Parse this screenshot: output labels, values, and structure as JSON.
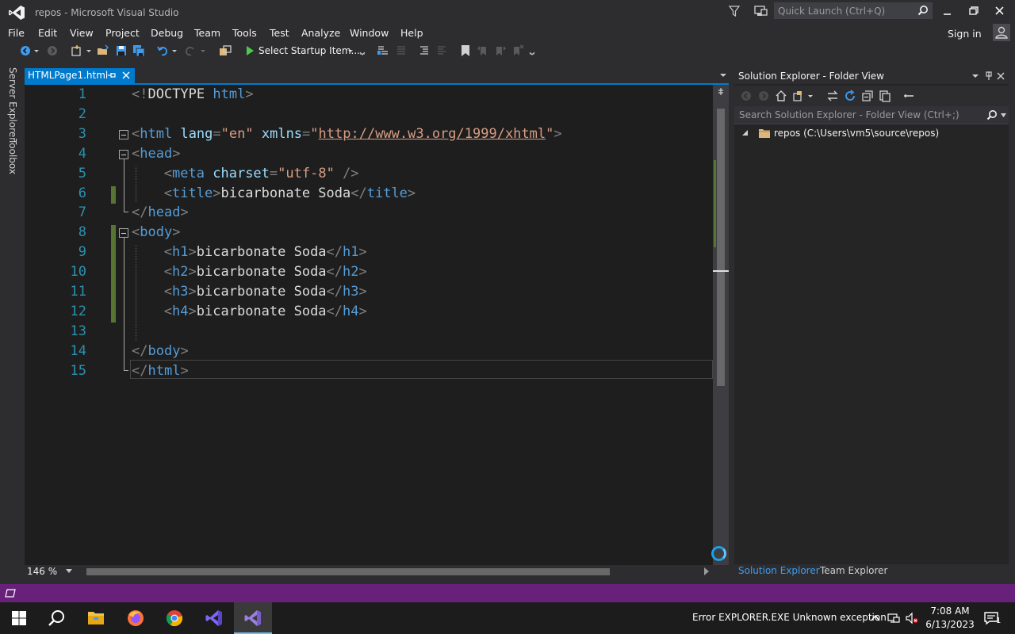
{
  "window": {
    "title": "repos - Microsoft Visual Studio"
  },
  "quick_launch": {
    "placeholder": "Quick Launch (Ctrl+Q)"
  },
  "menu": [
    "File",
    "Edit",
    "View",
    "Project",
    "Debug",
    "Team",
    "Tools",
    "Test",
    "Analyze",
    "Window",
    "Help"
  ],
  "account": {
    "sign_in": "Sign in"
  },
  "toolbar": {
    "startup_label": "Select Startup Item..."
  },
  "left_tabs": {
    "server_explorer": "Server Explorer",
    "toolbox": "Toolbox"
  },
  "document_tab": {
    "label": "HTMLPage1.html"
  },
  "editor": {
    "line_numbers": [
      "1",
      "2",
      "3",
      "4",
      "5",
      "6",
      "7",
      "8",
      "9",
      "10",
      "11",
      "12",
      "13",
      "14",
      "15"
    ],
    "tokens": {
      "l1": [
        "<!",
        "DOCTYPE",
        " ",
        "html",
        ">"
      ],
      "l3": [
        "<",
        "html",
        " ",
        "lang",
        "=",
        "\"en\"",
        " ",
        "xmlns",
        "=",
        "\"",
        "http://www.w3.org/1999/xhtml",
        "\"",
        ">"
      ],
      "l4": [
        "<",
        "head",
        ">"
      ],
      "l5": [
        "<",
        "meta",
        " ",
        "charset",
        "=",
        "\"utf-8\"",
        " />"
      ],
      "l6": [
        "<",
        "title",
        ">",
        "bicarbonate Soda",
        "</",
        "title",
        ">"
      ],
      "l7": [
        "</",
        "head",
        ">"
      ],
      "l8": [
        "<",
        "body",
        ">"
      ],
      "l9": [
        "<",
        "h1",
        ">",
        "bicarbonate Soda",
        "</",
        "h1",
        ">"
      ],
      "l10": [
        "<",
        "h2",
        ">",
        "bicarbonate Soda",
        "</",
        "h2",
        ">"
      ],
      "l11": [
        "<",
        "h3",
        ">",
        "bicarbonate Soda",
        "</",
        "h3",
        ">"
      ],
      "l12": [
        "<",
        "h4",
        ">",
        "bicarbonate Soda",
        "</",
        "h4",
        ">"
      ],
      "l14": [
        "</",
        "body",
        ">"
      ],
      "l15": [
        "</",
        "html",
        ">"
      ]
    },
    "zoom": "146 %"
  },
  "solution_explorer": {
    "title": "Solution Explorer - Folder View",
    "search_placeholder": "Search Solution Explorer - Folder View (Ctrl+;)",
    "root_label": "repos (C:\\Users\\vm5\\source\\repos)"
  },
  "panel_tabs": {
    "solution_explorer": "Solution Explorer",
    "team_explorer": "Team Explorer"
  },
  "taskbar": {
    "tray_error": "Error EXPLORER.EXE Unknown exception",
    "time": "7:08 AM",
    "date": "6/13/2023",
    "notification_count": "1"
  },
  "colors": {
    "accent": "#007acc",
    "status_bar": "#68217a",
    "editor_bg": "#1e1e1e",
    "chrome_bg": "#2d2d30"
  }
}
